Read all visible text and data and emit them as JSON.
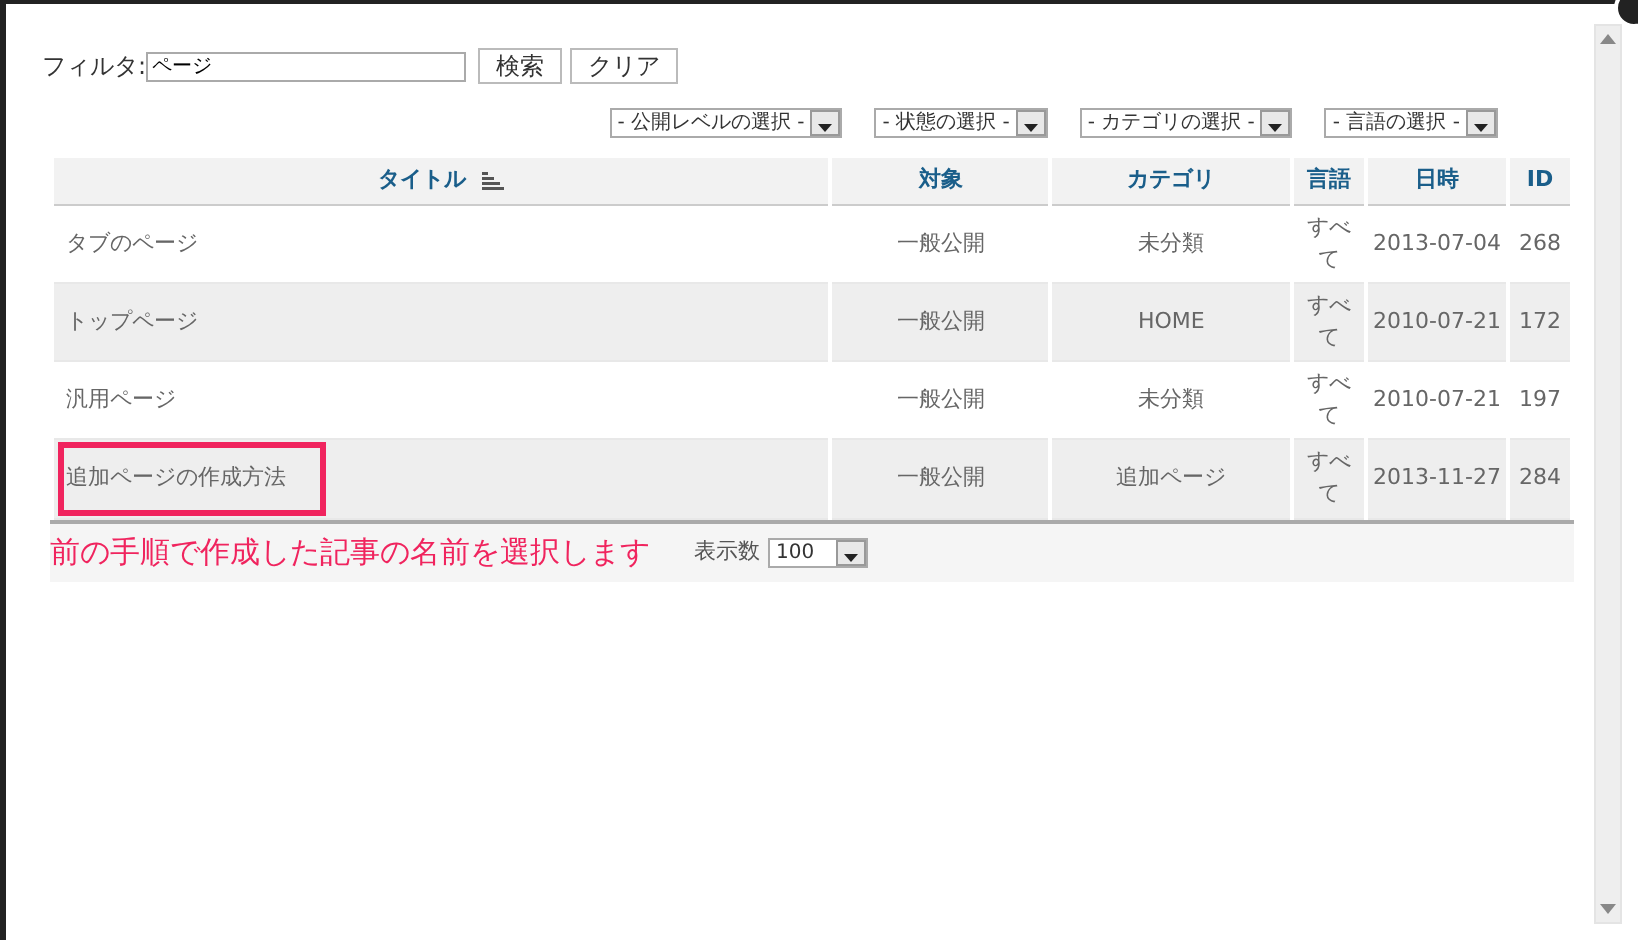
{
  "filter": {
    "label": "フィルタ:",
    "value": "ページ",
    "buttons": [
      "検索",
      "クリア"
    ]
  },
  "selects": [
    "- 公開レベルの選択 -",
    "- 状態の選択 -",
    "- カテゴリの選択 -",
    "- 言語の選択 -"
  ],
  "table": {
    "columns": [
      {
        "label": "タイトル",
        "sorted": true
      },
      {
        "label": "対象",
        "sorted": false
      },
      {
        "label": "カテゴリ",
        "sorted": false
      },
      {
        "label": "言語",
        "sorted": false
      },
      {
        "label": "日時",
        "sorted": false
      },
      {
        "label": "ID",
        "sorted": false
      }
    ],
    "rows": [
      {
        "cells": [
          "タブのページ",
          "一般公開",
          "未分類",
          "すべて",
          "2013-07-04",
          "268"
        ],
        "annotated": false
      },
      {
        "cells": [
          "トップページ",
          "一般公開",
          "HOME",
          "すべて",
          "2010-07-21",
          "172"
        ],
        "annotated": false
      },
      {
        "cells": [
          "汎用ページ",
          "一般公開",
          "未分類",
          "すべて",
          "2010-07-21",
          "197"
        ],
        "annotated": false
      },
      {
        "cells": [
          "追加ページの作成方法",
          "一般公開",
          "追加ページ",
          "すべて",
          "2013-11-27",
          "284"
        ],
        "annotated": true
      }
    ]
  },
  "annotation": "前の手順で作成した記事の名前を選択します",
  "page_size": {
    "label": "表示数",
    "value": "100"
  }
}
